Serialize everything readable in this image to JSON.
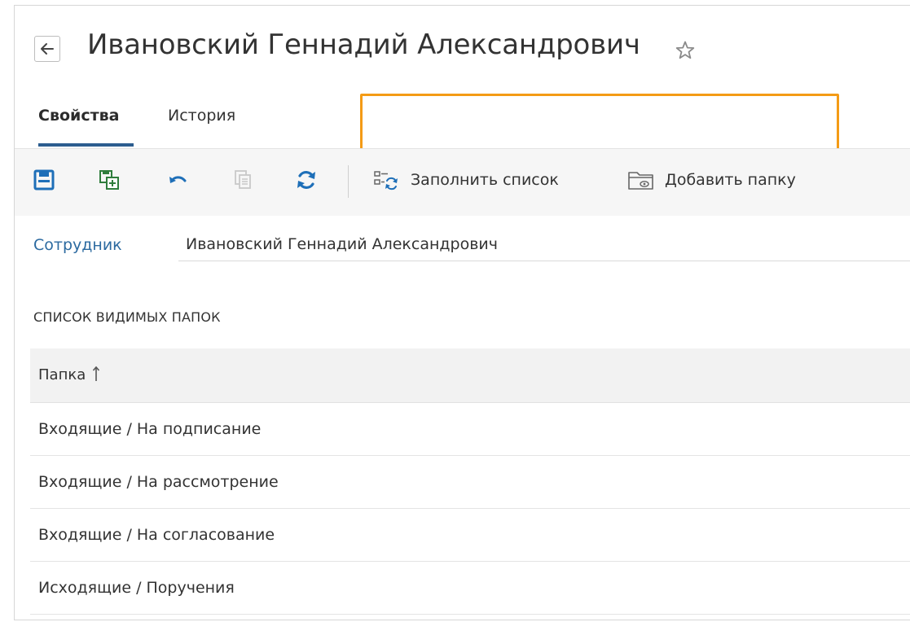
{
  "header": {
    "title": "Ивановский Геннадий Александрович"
  },
  "tabs": [
    {
      "label": "Свойства",
      "active": true
    },
    {
      "label": "История",
      "active": false
    }
  ],
  "toolbar": {
    "fill_list_label": "Заполнить список",
    "add_folder_label": "Добавить папку"
  },
  "form": {
    "employee_label": "Сотрудник",
    "employee_value": "Ивановский Геннадий Александрович"
  },
  "section": {
    "title": "СПИСОК ВИДИМЫХ ПАПОК"
  },
  "table": {
    "column_header": "Папка",
    "rows": [
      "Входящие / На подписание",
      "Входящие / На рассмотрение",
      "Входящие / На согласование",
      "Исходящие / Поручения"
    ]
  },
  "colors": {
    "accent": "#2c5d8f",
    "link": "#2c6aa0",
    "highlight": "#f49b16",
    "refresh": "#1e6fb8"
  },
  "icons": [
    "back-arrow-icon",
    "star-icon",
    "save-icon",
    "save-and-new-icon",
    "undo-icon",
    "copy-icon",
    "refresh-icon",
    "fill-list-icon",
    "add-folder-icon",
    "sort-ascending-icon"
  ]
}
